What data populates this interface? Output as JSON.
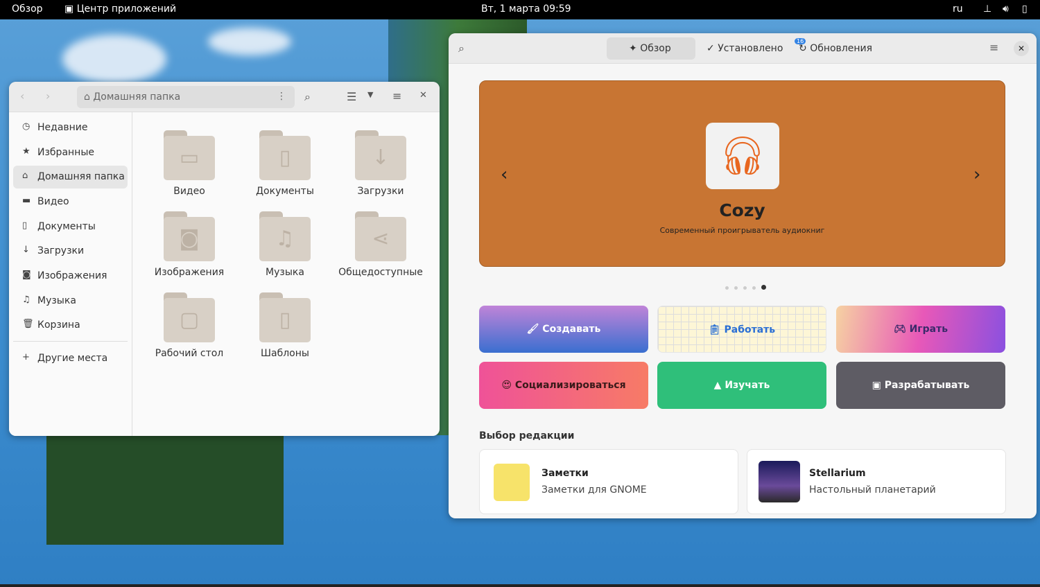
{
  "topbar": {
    "activities": "Обзор",
    "app": "Центр приложений",
    "clock": "Вт, 1 марта  09:59",
    "lang": "ru"
  },
  "files": {
    "path": "Домашняя папка",
    "sidebar": [
      "Недавние",
      "Избранные",
      "Домашняя папка",
      "Видео",
      "Документы",
      "Загрузки",
      "Изображения",
      "Музыка",
      "Корзина"
    ],
    "other": "Другие места",
    "folders": [
      "Видео",
      "Документы",
      "Загрузки",
      "Изображения",
      "Музыка",
      "Общедоступные",
      "Рабочий стол",
      "Шаблоны"
    ]
  },
  "software": {
    "tabs": [
      "Обзор",
      "Установлено",
      "Обновления"
    ],
    "updates_count": "16",
    "banner": {
      "title": "Cozy",
      "subtitle": "Современный проигрыватель аудиокниг",
      "color": "#c87533",
      "slides": 5,
      "current": 5
    },
    "categories": [
      "Создавать",
      "Работать",
      "Играть",
      "Социализироваться",
      "Изучать",
      "Разрабатывать"
    ],
    "editors_heading": "Выбор редакции",
    "picks": [
      {
        "name": "Заметки",
        "desc": "Заметки для GNOME"
      },
      {
        "name": "Stellarium",
        "desc": "Настольный планетарий"
      }
    ]
  }
}
